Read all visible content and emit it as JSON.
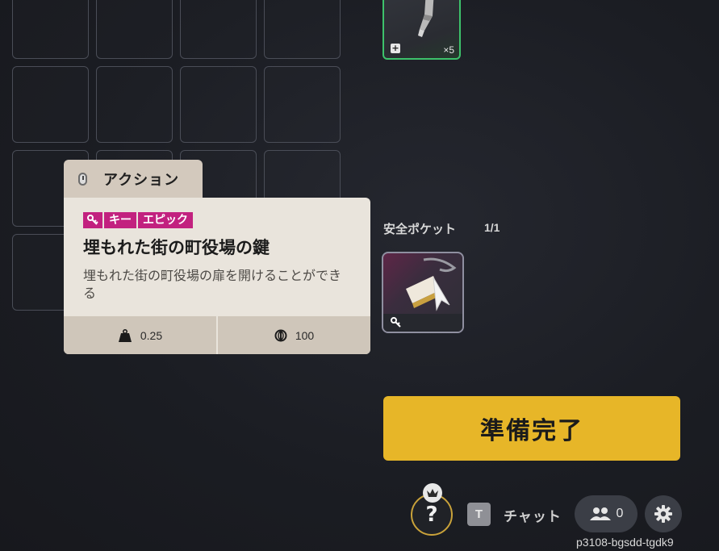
{
  "inventory": {
    "stack_item": {
      "count_label": "×5",
      "plus_icon": "plus-icon",
      "rarity_color": "#3dc26b"
    }
  },
  "tooltip": {
    "action_tab": {
      "label": "アクション",
      "icon": "mouse-icon"
    },
    "tags": [
      "キー",
      "エピック"
    ],
    "tag_icon": "key-icon",
    "tag_color": "#c2217f",
    "title": "埋もれた街の町役場の鍵",
    "description": "埋もれた街の町役場の扉を開けることができる",
    "weight": {
      "icon": "weight-icon",
      "value": "0.25"
    },
    "value": {
      "icon": "coin-icon",
      "value": "100"
    }
  },
  "safe_pocket": {
    "label": "安全ポケット",
    "count": "1/1",
    "item_icon": "key-icon"
  },
  "ready_button": {
    "label": "準備完了",
    "color": "#e7b628"
  },
  "bottom_bar": {
    "help_label": "?",
    "chat_key": "T",
    "chat_label": "チャット",
    "party_count": "0",
    "session_id": "p3108-bgsdd-tgdk9"
  }
}
